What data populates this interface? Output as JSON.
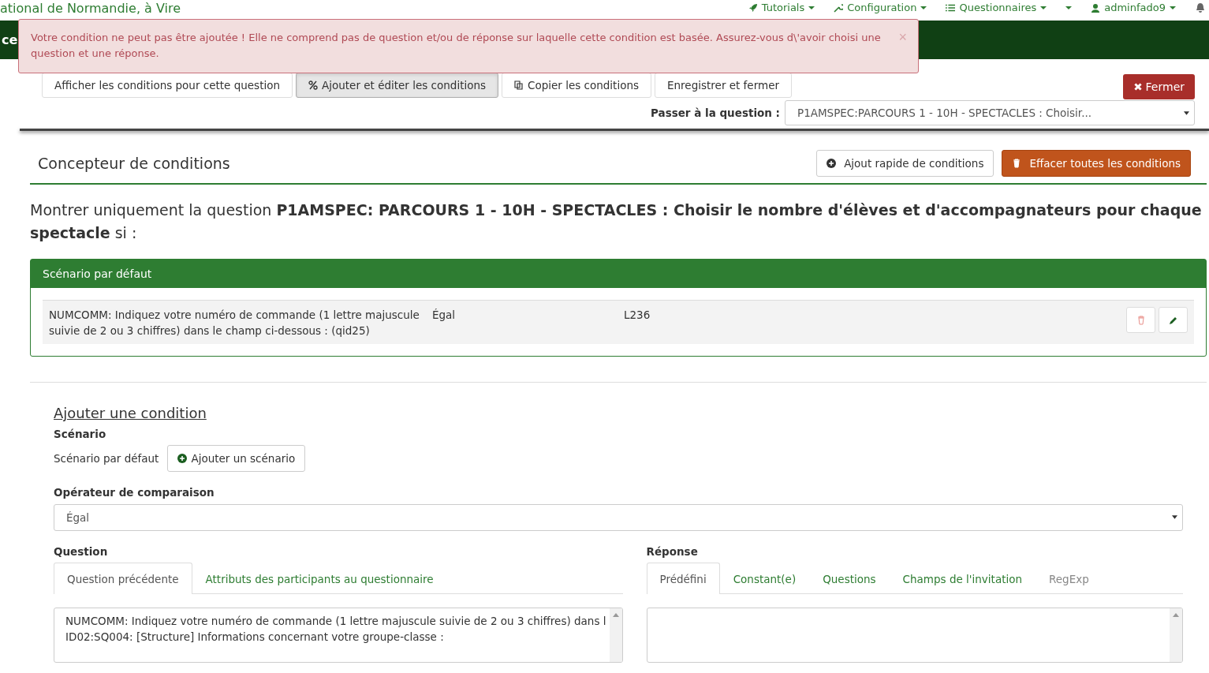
{
  "header": {
    "site_title": "ational de Normandie, à Vire",
    "nav": [
      {
        "label": "Tutorials"
      },
      {
        "label": "Configuration"
      },
      {
        "label": "Questionnaires"
      },
      {
        "label": "adminfado9"
      }
    ]
  },
  "green_bar": {
    "text": "ce"
  },
  "alert": {
    "message": "Votre condition ne peut pas être ajoutée ! Elle ne comprend pas de question et/ou de réponse sur laquelle cette condition est basée. Assurez-vous d\\'avoir choisi une question et une réponse.",
    "close": "×"
  },
  "toolbar": {
    "buttons": [
      {
        "label": "Afficher les conditions pour cette question",
        "selected": false
      },
      {
        "label": "Ajouter et éditer les conditions",
        "selected": true
      },
      {
        "label": "Copier les conditions",
        "selected": false
      },
      {
        "label": "Enregistrer et fermer",
        "selected": false
      }
    ],
    "close_button": "Fermer",
    "jump_label": "Passer à la question :",
    "jump_value": "P1AMSPEC:PARCOURS 1 - 10H - SPECTACLES : Choisir..."
  },
  "designer": {
    "title": "Concepteur de conditions",
    "quick_add": "Ajout rapide de conditions",
    "delete_all": "Effacer toutes les conditions"
  },
  "intro": "Montrer uniquement la question **P1AMSPEC: PARCOURS 1 - 10H - SPECTACLES : Choisir le nombre d'élèves et d'accompagnateurs pour chaque spectacle** si :",
  "scenario": {
    "title": "Scénario par défaut",
    "rows": [
      {
        "question": "NUMCOMM: Indiquez votre numéro de commande (1 lettre majuscule suivie de 2 ou 3 chiffres) dans le champ ci-dessous : (qid25)",
        "operator": "Égal",
        "value": "L236"
      }
    ]
  },
  "add_condition": {
    "title": "Ajouter une condition",
    "scenario_label": "Scénario",
    "scenario_value": "Scénario par défaut",
    "add_scenario": "Ajouter un scénario",
    "operator_label": "Opérateur de comparaison",
    "operator_value": "Égal",
    "question": {
      "label": "Question",
      "tabs": [
        {
          "label": "Question précédente",
          "selected": true
        },
        {
          "label": "Attributs des participants au questionnaire",
          "selected": false
        }
      ],
      "options": [
        "NUMCOMM: Indiquez votre numéro de commande (1 lettre majuscule suivie de 2 ou 3 chiffres) dans l",
        "ID02:SQ004: [Structure] Informations concernant votre groupe-classe :"
      ]
    },
    "answer": {
      "label": "Réponse",
      "tabs": [
        {
          "label": "Prédéfini",
          "selected": true,
          "disabled": false
        },
        {
          "label": "Constant(e)",
          "selected": false,
          "disabled": false
        },
        {
          "label": "Questions",
          "selected": false,
          "disabled": false
        },
        {
          "label": "Champs de l'invitation",
          "selected": false,
          "disabled": false
        },
        {
          "label": "RegExp",
          "selected": false,
          "disabled": true
        }
      ]
    }
  }
}
